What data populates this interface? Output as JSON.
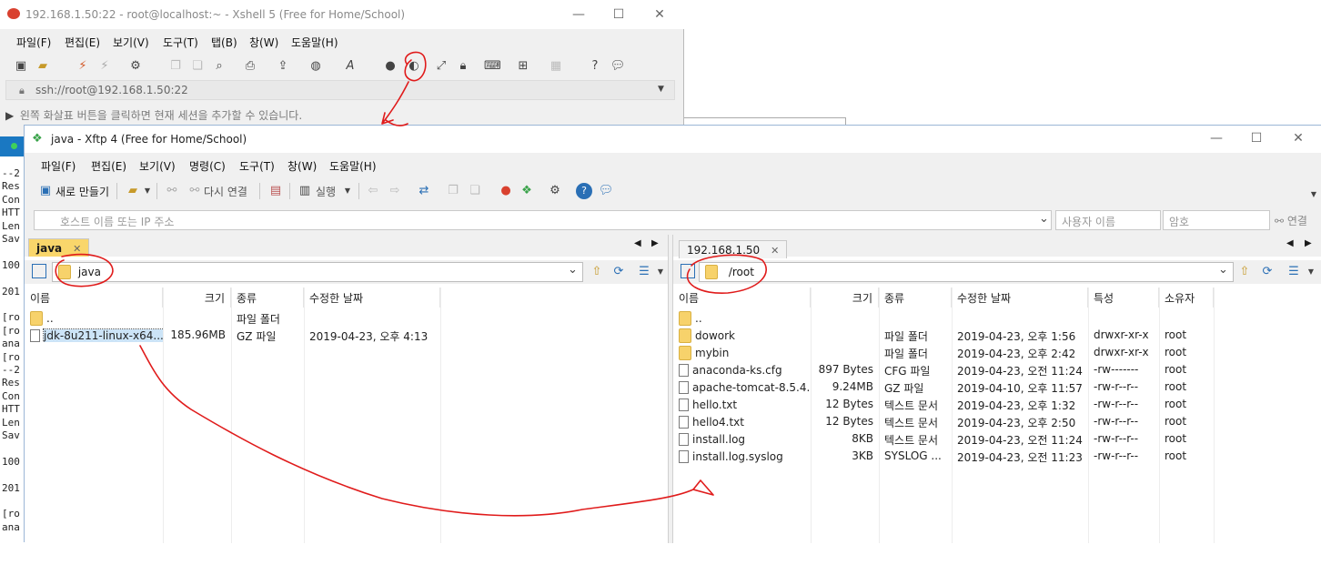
{
  "xshell": {
    "title": "192.168.1.50:22 - root@localhost:~ - Xshell 5 (Free for Home/School)",
    "menu": [
      "파일(F)",
      "편집(E)",
      "보기(V)",
      "도구(T)",
      "탭(B)",
      "창(W)",
      "도움말(H)"
    ],
    "address": "ssh://root@192.168.1.50:22",
    "hint": "왼쪽 화살표 버튼을 클릭하면 현재 세션을 추가할 수 있습니다."
  },
  "terminal": {
    "lines": [
      "--2",
      "Res",
      "Con",
      "HTT",
      "Len",
      "Sav",
      "",
      "100",
      "",
      "201",
      "",
      "[ro",
      "[ro",
      "ana",
      "[ro",
      "--2",
      "Res",
      "Con",
      "HTT",
      "Len",
      "Sav",
      "",
      "100",
      "",
      "201",
      "",
      "[ro",
      "ana"
    ]
  },
  "xftp": {
    "title": "java - Xftp 4 (Free for Home/School)",
    "menu": [
      "파일(F)",
      "편집(E)",
      "보기(V)",
      "명령(C)",
      "도구(T)",
      "창(W)",
      "도움말(H)"
    ],
    "toolbar": {
      "new_label": "새로 만들기",
      "reconnect_label": "다시 연결",
      "run_label": "실행"
    },
    "host_placeholder": "호스트 이름 또는 IP 주소",
    "user_placeholder": "사용자 이름",
    "password_placeholder": "암호",
    "connect_label": "연결",
    "left": {
      "tab": "java",
      "path": "java",
      "columns": [
        "이름",
        "크기",
        "종류",
        "수정한 날짜"
      ],
      "files": [
        {
          "name": "..",
          "size": "",
          "type": "파일 폴더",
          "date": "",
          "icon": "folder-icon"
        },
        {
          "name": "jdk-8u211-linux-x64....",
          "size": "185.96MB",
          "type": "GZ 파일",
          "date": "2019-04-23, 오후 4:13",
          "icon": "file-icon"
        }
      ]
    },
    "right": {
      "tab": "192.168.1.50",
      "path": "/root",
      "columns": [
        "이름",
        "크기",
        "종류",
        "수정한 날짜",
        "특성",
        "소유자"
      ],
      "files": [
        {
          "name": "..",
          "size": "",
          "type": "",
          "date": "",
          "attr": "",
          "owner": "",
          "icon": "folder-icon"
        },
        {
          "name": "dowork",
          "size": "",
          "type": "파일 폴더",
          "date": "2019-04-23, 오후 1:56",
          "attr": "drwxr-xr-x",
          "owner": "root",
          "icon": "folder-icon"
        },
        {
          "name": "mybin",
          "size": "",
          "type": "파일 폴더",
          "date": "2019-04-23, 오후 2:42",
          "attr": "drwxr-xr-x",
          "owner": "root",
          "icon": "folder-icon"
        },
        {
          "name": "anaconda-ks.cfg",
          "size": "897 Bytes",
          "type": "CFG 파일",
          "date": "2019-04-23, 오전 11:24",
          "attr": "-rw-------",
          "owner": "root",
          "icon": "file-icon"
        },
        {
          "name": "apache-tomcat-8.5.4...",
          "size": "9.24MB",
          "type": "GZ 파일",
          "date": "2019-04-10, 오후 11:57",
          "attr": "-rw-r--r--",
          "owner": "root",
          "icon": "file-icon"
        },
        {
          "name": "hello.txt",
          "size": "12 Bytes",
          "type": "텍스트 문서",
          "date": "2019-04-23, 오후 1:32",
          "attr": "-rw-r--r--",
          "owner": "root",
          "icon": "file-icon"
        },
        {
          "name": "hello4.txt",
          "size": "12 Bytes",
          "type": "텍스트 문서",
          "date": "2019-04-23, 오후 2:50",
          "attr": "-rw-r--r--",
          "owner": "root",
          "icon": "file-icon"
        },
        {
          "name": "install.log",
          "size": "8KB",
          "type": "텍스트 문서",
          "date": "2019-04-23, 오전 11:24",
          "attr": "-rw-r--r--",
          "owner": "root",
          "icon": "file-icon"
        },
        {
          "name": "install.log.syslog",
          "size": "3KB",
          "type": "SYSLOG ...",
          "date": "2019-04-23, 오전 11:23",
          "attr": "-rw-r--r--",
          "owner": "root",
          "icon": "file-icon"
        }
      ]
    }
  },
  "colors": {
    "selection": "#cce4f7",
    "annotation": "#e01b1b",
    "tab_active": "#f9d66b"
  }
}
